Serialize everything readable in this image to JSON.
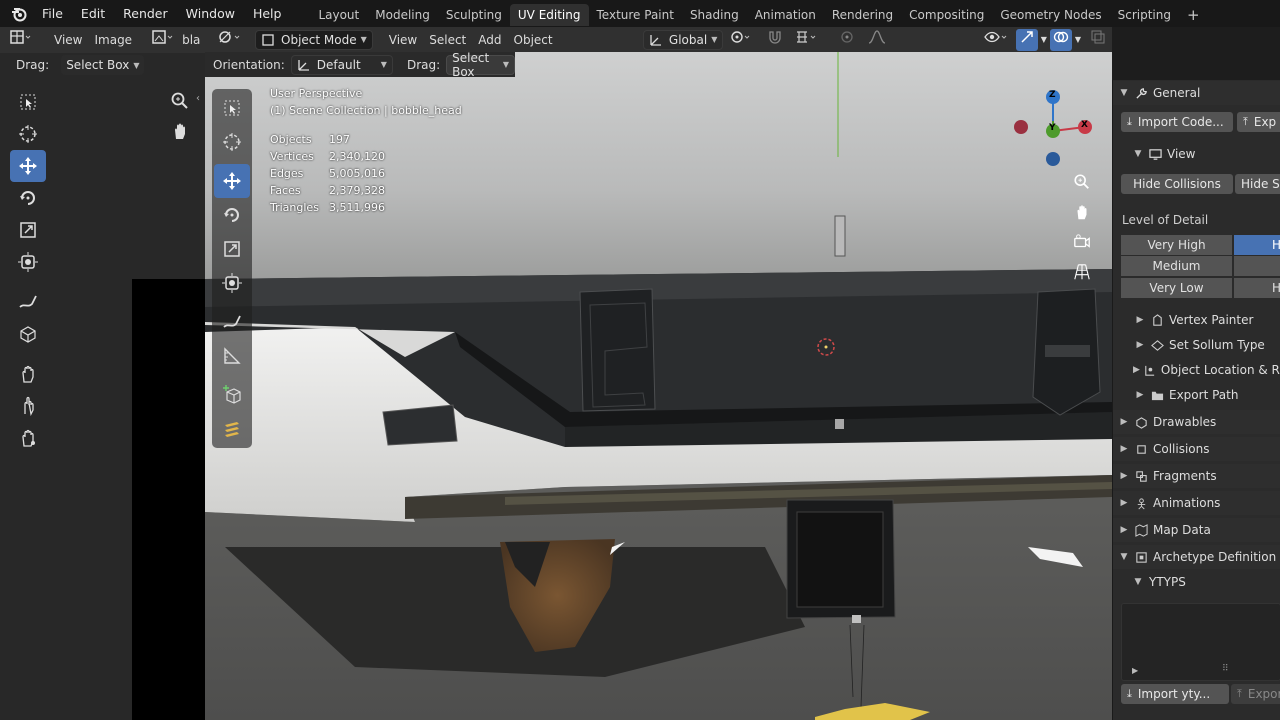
{
  "topbar": {
    "menus": [
      "File",
      "Edit",
      "Render",
      "Window",
      "Help"
    ],
    "workspaces": [
      "Layout",
      "Modeling",
      "Sculpting",
      "UV Editing",
      "Texture Paint",
      "Shading",
      "Animation",
      "Rendering",
      "Compositing",
      "Geometry Nodes",
      "Scripting"
    ],
    "active_workspace": "UV Editing",
    "add_tab_icon": "plus-icon"
  },
  "left_editor": {
    "view_label": "View",
    "image_label": "Image",
    "image_name_partial": "bla",
    "drag_label": "Drag:",
    "drag_value": "Select Box"
  },
  "viewport": {
    "mode": "Object Mode",
    "menus": [
      "View",
      "Select",
      "Add",
      "Object"
    ],
    "transform_orientation": "Global",
    "orientation_label": "Orientation:",
    "orientation_value": "Default",
    "drag_label": "Drag:",
    "drag_value": "Select Box",
    "perspective": "User Perspective",
    "collection": "(1) Scene Collection | bobble_head",
    "stats": [
      {
        "label": "Objects",
        "value": "197"
      },
      {
        "label": "Vertices",
        "value": "2,340,120"
      },
      {
        "label": "Edges",
        "value": "5,005,016"
      },
      {
        "label": "Faces",
        "value": "2,379,328"
      },
      {
        "label": "Triangles",
        "value": "3,511,996"
      }
    ],
    "gizmo_axes": {
      "z": "Z",
      "y": "Y",
      "x": "X"
    },
    "colors": {
      "x": "#c83a47",
      "y": "#4e9b2c",
      "z": "#2f75c9",
      "selected_tool": "#4772b3"
    }
  },
  "properties": {
    "general": "General",
    "import_code": "Import Code...",
    "export_partial": "Exp",
    "view": "View",
    "hide_collisions": "Hide Collisions",
    "hide_partial": "Hide Sh",
    "lod_title": "Level of Detail",
    "lod_rows": [
      {
        "name": "Very High",
        "value": "H"
      },
      {
        "name": "Medium",
        "value": ""
      },
      {
        "name": "Very Low",
        "value": "H"
      }
    ],
    "subpanels": [
      "Vertex Painter",
      "Set Sollum Type",
      "Object Location & Rot",
      "Export Path"
    ],
    "panels": [
      "Drawables",
      "Collisions",
      "Fragments",
      "Animations",
      "Map Data"
    ],
    "archetype": "Archetype Definition",
    "ytyps": "YTYPS",
    "import_ytyp": "Import yty...",
    "export_label": "Export"
  }
}
